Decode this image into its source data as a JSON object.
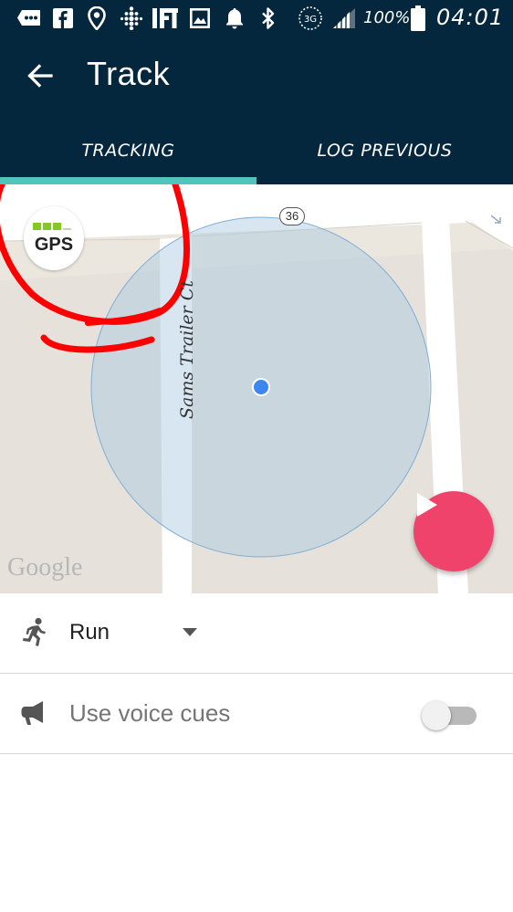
{
  "status_bar": {
    "battery_percent": "100%",
    "time": "04:01",
    "network": "3G",
    "icons": [
      "message-icon",
      "facebook-icon",
      "location-pin-icon",
      "fitbit-icon",
      "ifttt-icon",
      "image-icon",
      "notification-bell-icon",
      "bluetooth-icon",
      "network-3g-icon",
      "signal-icon",
      "battery-icon"
    ]
  },
  "header": {
    "title": "Track",
    "back_icon": "arrow-back-icon"
  },
  "tabs": [
    {
      "label": "TRACKING",
      "selected": true
    },
    {
      "label": "LOG PREVIOUS",
      "selected": false
    }
  ],
  "map": {
    "gps_label": "GPS",
    "gps_signal_bars": {
      "filled": 3,
      "total": 4
    },
    "street_name": "Sams Trailer Ct",
    "route_number": "36",
    "attribution": "Google",
    "start_icon": "play-icon"
  },
  "settings": {
    "activity": {
      "icon": "running-person-icon",
      "value": "Run"
    },
    "voice_cues": {
      "icon": "megaphone-icon",
      "label": "Use voice cues",
      "enabled": false
    }
  },
  "colors": {
    "header_bg": "#04273d",
    "tab_indicator": "#52c2bd",
    "play_button": "#f0436b",
    "gps_signal": "#85c724",
    "location_dot": "#3d86f0",
    "annotation": "#ff0000"
  }
}
